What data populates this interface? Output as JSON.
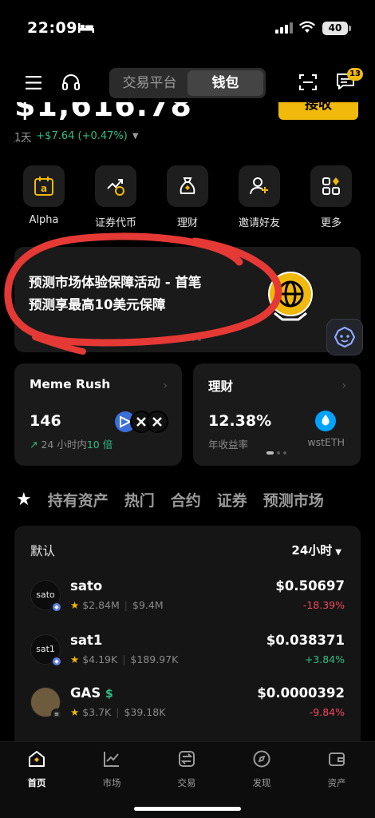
{
  "status_bar": {
    "time": "22:09",
    "battery": "40"
  },
  "header": {
    "segments": [
      "交易平台",
      "钱包"
    ],
    "active_segment": "钱包",
    "notification_count": "13"
  },
  "balance": {
    "amount": "$1,616.78",
    "deposit_label": "接收"
  },
  "pnl": {
    "period": "1天",
    "value": "+$7.64 (+0.47%)"
  },
  "quick_actions": [
    {
      "label": "Alpha",
      "icon": "alpha-icon"
    },
    {
      "label": "证券代币",
      "icon": "stock-token-icon"
    },
    {
      "label": "理财",
      "icon": "earn-bag-icon"
    },
    {
      "label": "邀请好友",
      "icon": "invite-friend-icon"
    },
    {
      "label": "更多",
      "icon": "more-grid-icon"
    }
  ],
  "promo": {
    "line1": "预测市场体验保障活动 - 首笔",
    "line2": "预测享最高10美元保障",
    "accent": "#f0b90b",
    "annotation_color": "#e53935"
  },
  "cards": {
    "meme": {
      "title": "Meme Rush",
      "value": "146",
      "sub_prefix": "24 小时内",
      "sub_highlight": "10 倍"
    },
    "earn": {
      "title": "理财",
      "value": "12.38%",
      "sub": "年收益率",
      "token": "wstETH"
    }
  },
  "tabs": [
    "持有资产",
    "热门",
    "合约",
    "证券",
    "预测市场"
  ],
  "list": {
    "header": "默认",
    "period": "24小时",
    "rows": [
      {
        "avatar_text": "sato",
        "name": "sato",
        "mcap": "$2.84M",
        "volume": "$9.4M",
        "price": "$0.50697",
        "change": "-18.39%",
        "direction": "down"
      },
      {
        "avatar_text": "sat1",
        "name": "sat1",
        "mcap": "$4.19K",
        "volume": "$189.97K",
        "price": "$0.038371",
        "change": "+3.84%",
        "direction": "up"
      },
      {
        "avatar_text": "",
        "name": "GAS",
        "mcap": "$3.7K",
        "volume": "$39.18K",
        "price": "$0.0000392",
        "change": "-9.84%",
        "direction": "down"
      }
    ]
  },
  "bottom_nav": [
    {
      "label": "首页",
      "icon": "home-icon",
      "active": true
    },
    {
      "label": "市场",
      "icon": "market-chart-icon",
      "active": false
    },
    {
      "label": "交易",
      "icon": "trade-swap-icon",
      "active": false
    },
    {
      "label": "发现",
      "icon": "discover-compass-icon",
      "active": false
    },
    {
      "label": "资产",
      "icon": "wallet-icon",
      "active": false
    }
  ],
  "colors": {
    "accent": "#f0b90b",
    "positive": "#2ebd85",
    "negative": "#f6465d",
    "background": "#000000"
  }
}
